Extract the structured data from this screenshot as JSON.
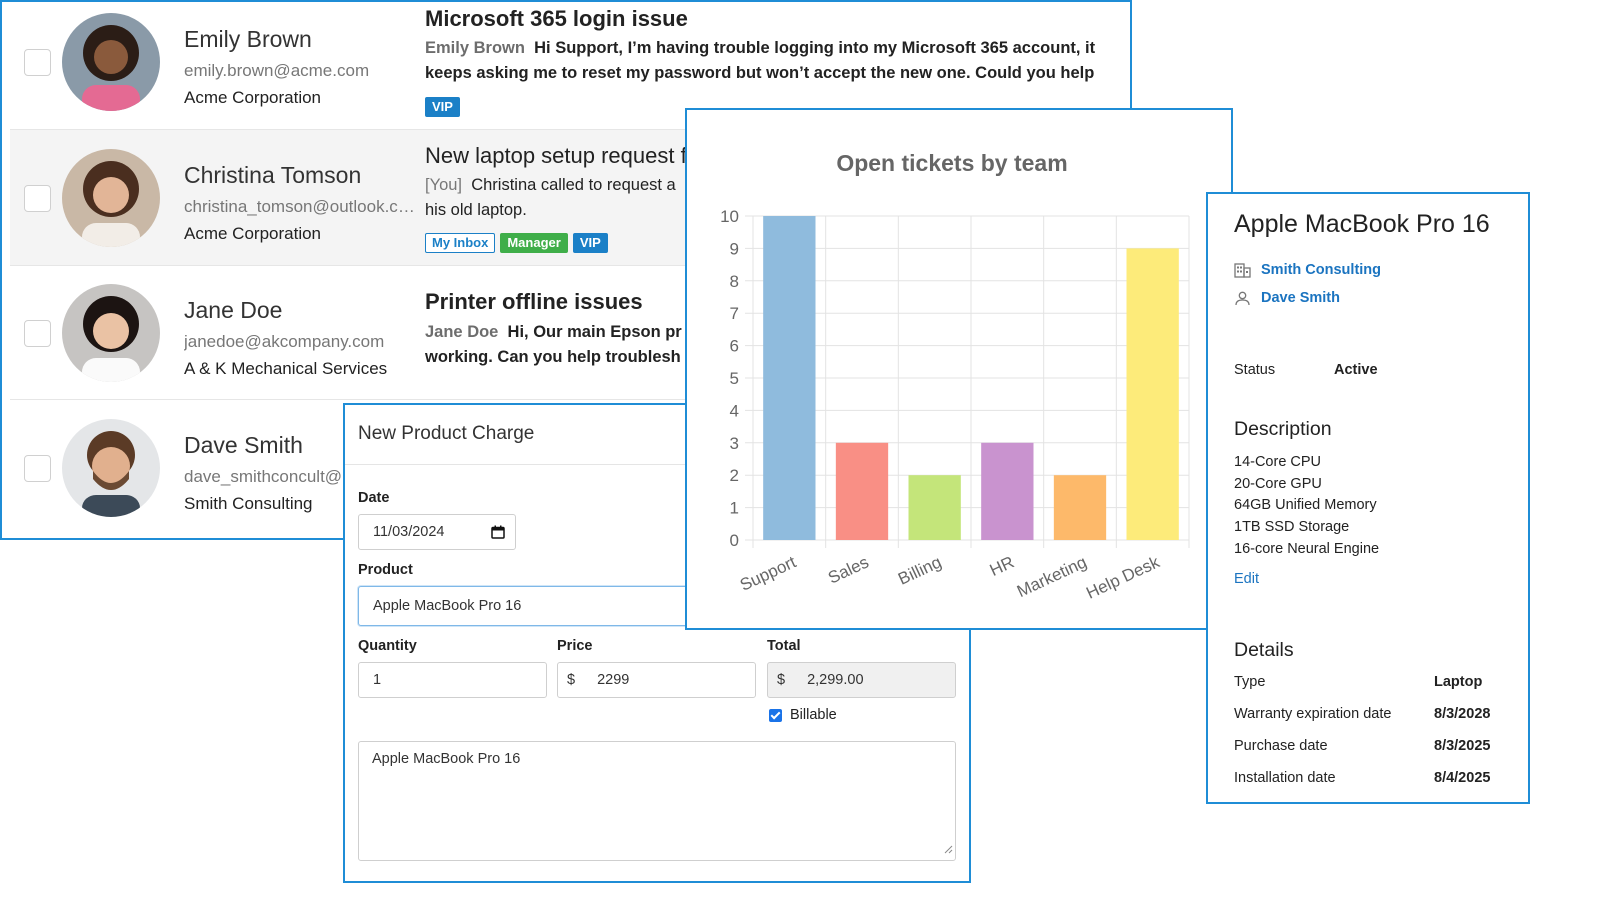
{
  "tickets": [
    {
      "contact_name": "Emily Brown",
      "email": "emily.brown@acme.com",
      "company": "Acme Corporation",
      "subject": "Microsoft 365 login issue",
      "author": "Emily Brown",
      "preview_first": "Hi Support, I’m having trouble logging into my Microsoft 365 account, it",
      "preview_second": "keeps asking me to reset my password but won’t accept the new one. Could you help",
      "tags": [
        "VIP"
      ]
    },
    {
      "contact_name": "Christina Tomson",
      "email": "christina_tomson@outlook.com",
      "company": "Acme Corporation",
      "subject": "New laptop setup request f",
      "author": "[You]",
      "preview_first": "Christina called to request a",
      "preview_second": "his old laptop.",
      "tags": [
        "My Inbox",
        "Manager",
        "VIP"
      ]
    },
    {
      "contact_name": "Jane Doe",
      "email": "janedoe@akcompany.com",
      "company": "A & K Mechanical Services",
      "subject": "Printer offline issues",
      "author": "Jane Doe",
      "preview_first": "Hi, Our main Epson pr",
      "preview_second": "working. Can you help troublesh"
    },
    {
      "contact_name": "Dave Smith",
      "email": "dave_smithconcult@",
      "company": "Smith Consulting"
    }
  ],
  "charge_form": {
    "title": "New Product Charge",
    "date_label": "Date",
    "date_value": "11/03/2024",
    "product_label": "Product",
    "product_value": "Apple MacBook Pro 16",
    "quantity_label": "Quantity",
    "quantity_value": "1",
    "price_label": "Price",
    "price_currency": "$",
    "price_value": "2299",
    "total_label": "Total",
    "total_currency": "$",
    "total_value": "2,299.00",
    "billable_label": "Billable",
    "notes_value": "Apple MacBook Pro 16"
  },
  "chart_data": {
    "type": "bar",
    "title": "Open tickets by team",
    "categories": [
      "Support",
      "Sales",
      "Billing",
      "HR",
      "Marketing",
      "Help Desk"
    ],
    "values": [
      10,
      3,
      2,
      3,
      2,
      9
    ],
    "colors": [
      "#8fbbdd",
      "#f98f85",
      "#c4e57a",
      "#c993cf",
      "#fdb96a",
      "#fdeb7a"
    ],
    "ylim": [
      0,
      10
    ],
    "yticks": [
      "0",
      "1",
      "2",
      "3",
      "4",
      "5",
      "6",
      "7",
      "8",
      "9",
      "10"
    ],
    "grid": true,
    "legend": "none"
  },
  "asset": {
    "title": "Apple MacBook Pro 16",
    "company_link": "Smith Consulting",
    "contact_link": "Dave Smith",
    "status_label": "Status",
    "status_value": "Active",
    "description_heading": "Description",
    "description_lines": [
      "14-Core CPU",
      "20-Core GPU",
      "64GB Unified Memory",
      "1TB SSD Storage",
      "16-core Neural Engine"
    ],
    "edit_label": "Edit",
    "details_heading": "Details",
    "details": [
      {
        "label": "Type",
        "value": "Laptop"
      },
      {
        "label": "Warranty expiration date",
        "value": "8/3/2028"
      },
      {
        "label": "Purchase date",
        "value": "8/3/2025"
      },
      {
        "label": "Installation date",
        "value": "8/4/2025"
      }
    ]
  }
}
